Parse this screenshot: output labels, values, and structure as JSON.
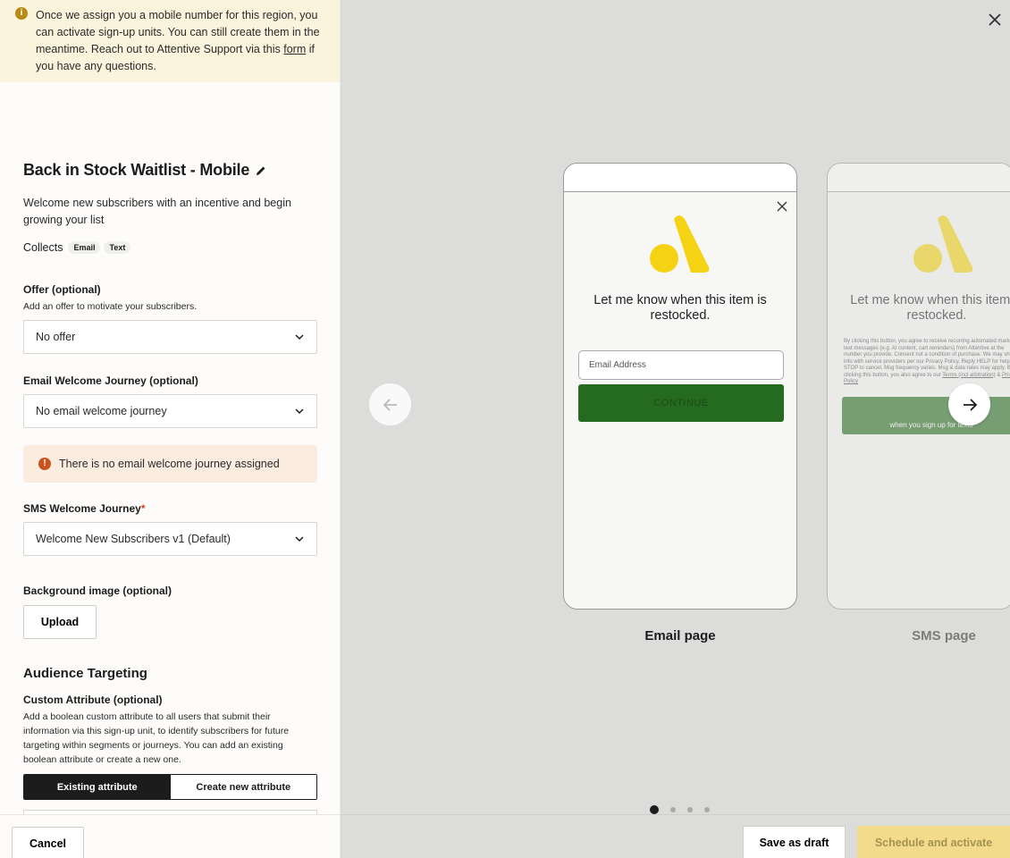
{
  "banner": {
    "text_before_link": "Once we assign you a mobile number for this region, you can activate sign-up units. You can still create them in the meantime. Reach out to Attentive Support via this ",
    "link_text": "form",
    "text_after_link": " if you have any questions."
  },
  "unit": {
    "title": "Back in Stock Waitlist - Mobile",
    "description": "Welcome new subscribers with an incentive and begin growing your list",
    "collects_label": "Collects",
    "collects_chips": [
      "Email",
      "Text"
    ]
  },
  "offer": {
    "label": "Offer (optional)",
    "sublabel": "Add an offer to motivate your subscribers.",
    "value": "No offer"
  },
  "email_journey": {
    "label": "Email Welcome Journey (optional)",
    "value": "No email welcome journey",
    "warning": "There is no email welcome journey assigned"
  },
  "sms_journey": {
    "label": "SMS Welcome Journey",
    "required_mark": "*",
    "value": "Welcome New Subscribers v1 (Default)"
  },
  "background_image": {
    "label": "Background image (optional)",
    "button": "Upload"
  },
  "audience": {
    "section_title": "Audience Targeting",
    "custom_attr_label": "Custom Attribute (optional)",
    "custom_attr_desc": "Add a boolean custom attribute to all users that submit their information via this sign-up unit, to identify subscribers for future targeting within segments or journeys. You can add an existing boolean attribute or create a new one.",
    "toggle_existing": "Existing attribute",
    "toggle_new": "Create new attribute"
  },
  "footer": {
    "cancel": "Cancel",
    "save_draft": "Save as draft",
    "schedule": "Schedule and activate"
  },
  "preview": {
    "email_page": {
      "headline": "Let me know when this item is restocked.",
      "email_placeholder": "Email Address",
      "cta": "CONTINUE",
      "caption": "Email page"
    },
    "sms_page": {
      "headline": "Let me know when this item is restocked.",
      "legal_text": "By clicking this button, you agree to receive recurring automated marketing text messages (e.g. AI content, cart reminders) from Attentive at the number you provide. Consent not a condition of purchase. We may share info with service providers per our Privacy Policy. Reply HELP for help & STOP to cancel. Msg frequency varies. Msg & data rates may apply. By clicking this button, you also agree to our ",
      "legal_link_terms": "Terms (incl arbitration)",
      "legal_amp": " & ",
      "legal_link_privacy": "Privacy Policy",
      "cta_sub": "when you sign up for texts",
      "caption": "SMS page"
    },
    "page_count": 4,
    "active_page": 1
  },
  "colors": {
    "banner_bg": "#fbf4dd",
    "cta_green": "#256b1f",
    "brand_yellow": "#f5d312",
    "activate_bg": "#f2dc8b",
    "warning_bg": "#fbece0"
  }
}
